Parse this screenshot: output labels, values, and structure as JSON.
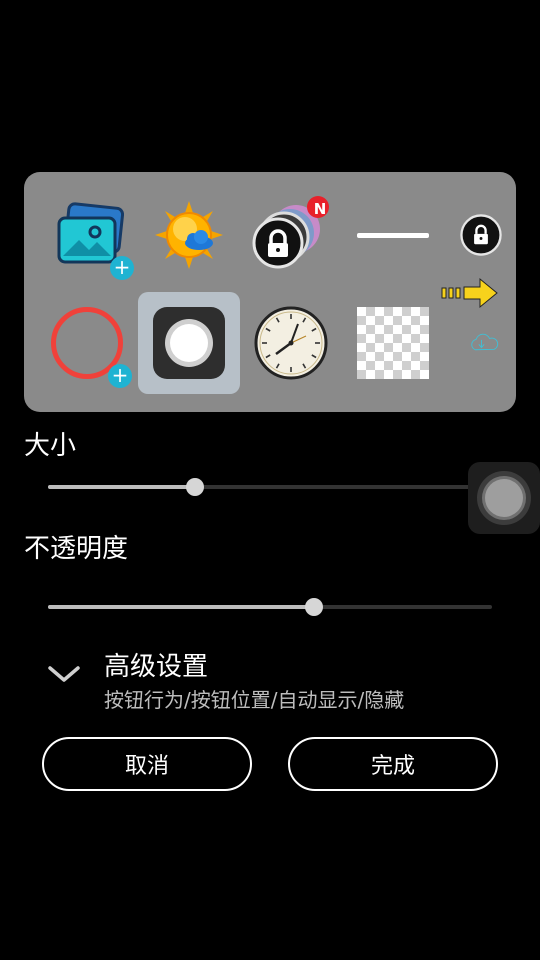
{
  "icons": [
    {
      "name": "gallery-icon",
      "has_add": true
    },
    {
      "name": "sun-weather-icon"
    },
    {
      "name": "lock-stack-icon",
      "badge": "N"
    },
    {
      "name": "dash-icon"
    },
    {
      "name": "lock-circle-icon"
    },
    {
      "name": "red-ring-icon",
      "has_add": true
    },
    {
      "name": "assistive-touch-icon",
      "selected": true
    },
    {
      "name": "clock-icon"
    },
    {
      "name": "transparent-icon"
    },
    {
      "name": "cloud-download-icon"
    },
    {
      "name": "yellow-arrow-icon"
    }
  ],
  "size": {
    "label": "大小",
    "value": 0.33
  },
  "opacity": {
    "label": "不透明度",
    "value": 0.6
  },
  "advanced": {
    "title": "高级设置",
    "subtitle": "按钮行为/按钮位置/自动显示/隐藏"
  },
  "actions": {
    "cancel": "取消",
    "done": "完成"
  },
  "colors": {
    "accent": "#1fb3d2",
    "badge": "#e8202a"
  }
}
